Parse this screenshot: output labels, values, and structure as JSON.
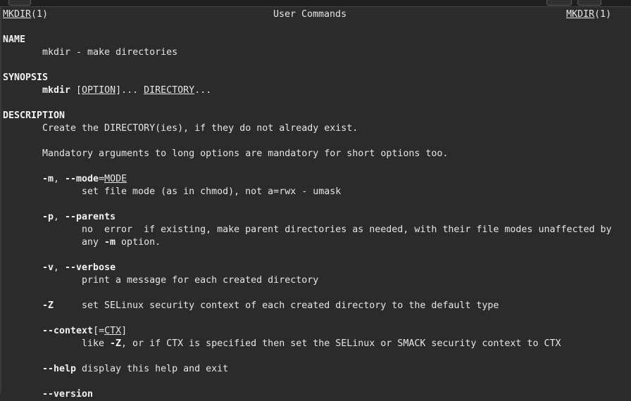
{
  "header": {
    "left_name": "MKDIR",
    "left_sect": "(1)",
    "center": "User Commands",
    "right_name": "MKDIR",
    "right_sect": "(1)"
  },
  "name_section": {
    "heading": "NAME",
    "text": "mkdir - make directories"
  },
  "synopsis": {
    "heading": "SYNOPSIS",
    "cmd": "mkdir",
    "t1": " [",
    "option": "OPTION",
    "t2": "]... ",
    "directory": "DIRECTORY",
    "t3": "..."
  },
  "description": {
    "heading": "DESCRIPTION",
    "line1": "Create the DIRECTORY(ies), if they do not already exist.",
    "line2": "Mandatory arguments to long options are mandatory for short options too."
  },
  "options": {
    "mode": {
      "short": "-m",
      "sep": ", ",
      "long": "--mode",
      "eq": "=",
      "arg": "MODE",
      "desc": "set file mode (as in chmod), not a=rwx - umask"
    },
    "parents": {
      "short": "-p",
      "sep": ", ",
      "long": "--parents",
      "desc1": "no  error  if existing, make parent directories as needed, with their file modes unaffected by",
      "desc2a": "any ",
      "desc2b": "-m",
      "desc2c": " option."
    },
    "verbose": {
      "short": "-v",
      "sep": ", ",
      "long": "--verbose",
      "desc": "print a message for each created directory"
    },
    "selinux": {
      "short": "-Z",
      "desc": "set SELinux security context of each created directory to the default type"
    },
    "context": {
      "long": "--context",
      "t1": "[=",
      "arg": "CTX",
      "t2": "]",
      "desc_a": "like ",
      "desc_b": "-Z",
      "desc_c": ", or if CTX is specified then set the SELinux or SMACK security context to CTX"
    },
    "help": {
      "long": "--help",
      "desc": " display this help and exit"
    },
    "version": {
      "long": "--version"
    }
  }
}
